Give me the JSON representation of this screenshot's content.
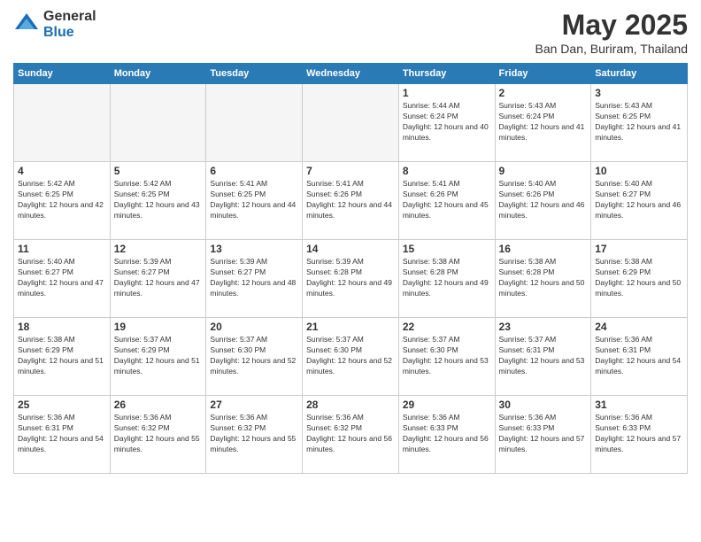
{
  "logo": {
    "general": "General",
    "blue": "Blue"
  },
  "title": "May 2025",
  "location": "Ban Dan, Buriram, Thailand",
  "weekdays": [
    "Sunday",
    "Monday",
    "Tuesday",
    "Wednesday",
    "Thursday",
    "Friday",
    "Saturday"
  ],
  "weeks": [
    [
      {
        "day": "",
        "empty": true
      },
      {
        "day": "",
        "empty": true
      },
      {
        "day": "",
        "empty": true
      },
      {
        "day": "",
        "empty": true
      },
      {
        "day": "1",
        "sunrise": "5:44 AM",
        "sunset": "6:24 PM",
        "daylight": "12 hours and 40 minutes."
      },
      {
        "day": "2",
        "sunrise": "5:43 AM",
        "sunset": "6:24 PM",
        "daylight": "12 hours and 41 minutes."
      },
      {
        "day": "3",
        "sunrise": "5:43 AM",
        "sunset": "6:25 PM",
        "daylight": "12 hours and 41 minutes."
      }
    ],
    [
      {
        "day": "4",
        "sunrise": "5:42 AM",
        "sunset": "6:25 PM",
        "daylight": "12 hours and 42 minutes."
      },
      {
        "day": "5",
        "sunrise": "5:42 AM",
        "sunset": "6:25 PM",
        "daylight": "12 hours and 43 minutes."
      },
      {
        "day": "6",
        "sunrise": "5:41 AM",
        "sunset": "6:25 PM",
        "daylight": "12 hours and 44 minutes."
      },
      {
        "day": "7",
        "sunrise": "5:41 AM",
        "sunset": "6:26 PM",
        "daylight": "12 hours and 44 minutes."
      },
      {
        "day": "8",
        "sunrise": "5:41 AM",
        "sunset": "6:26 PM",
        "daylight": "12 hours and 45 minutes."
      },
      {
        "day": "9",
        "sunrise": "5:40 AM",
        "sunset": "6:26 PM",
        "daylight": "12 hours and 46 minutes."
      },
      {
        "day": "10",
        "sunrise": "5:40 AM",
        "sunset": "6:27 PM",
        "daylight": "12 hours and 46 minutes."
      }
    ],
    [
      {
        "day": "11",
        "sunrise": "5:40 AM",
        "sunset": "6:27 PM",
        "daylight": "12 hours and 47 minutes."
      },
      {
        "day": "12",
        "sunrise": "5:39 AM",
        "sunset": "6:27 PM",
        "daylight": "12 hours and 47 minutes."
      },
      {
        "day": "13",
        "sunrise": "5:39 AM",
        "sunset": "6:27 PM",
        "daylight": "12 hours and 48 minutes."
      },
      {
        "day": "14",
        "sunrise": "5:39 AM",
        "sunset": "6:28 PM",
        "daylight": "12 hours and 49 minutes."
      },
      {
        "day": "15",
        "sunrise": "5:38 AM",
        "sunset": "6:28 PM",
        "daylight": "12 hours and 49 minutes."
      },
      {
        "day": "16",
        "sunrise": "5:38 AM",
        "sunset": "6:28 PM",
        "daylight": "12 hours and 50 minutes."
      },
      {
        "day": "17",
        "sunrise": "5:38 AM",
        "sunset": "6:29 PM",
        "daylight": "12 hours and 50 minutes."
      }
    ],
    [
      {
        "day": "18",
        "sunrise": "5:38 AM",
        "sunset": "6:29 PM",
        "daylight": "12 hours and 51 minutes."
      },
      {
        "day": "19",
        "sunrise": "5:37 AM",
        "sunset": "6:29 PM",
        "daylight": "12 hours and 51 minutes."
      },
      {
        "day": "20",
        "sunrise": "5:37 AM",
        "sunset": "6:30 PM",
        "daylight": "12 hours and 52 minutes."
      },
      {
        "day": "21",
        "sunrise": "5:37 AM",
        "sunset": "6:30 PM",
        "daylight": "12 hours and 52 minutes."
      },
      {
        "day": "22",
        "sunrise": "5:37 AM",
        "sunset": "6:30 PM",
        "daylight": "12 hours and 53 minutes."
      },
      {
        "day": "23",
        "sunrise": "5:37 AM",
        "sunset": "6:31 PM",
        "daylight": "12 hours and 53 minutes."
      },
      {
        "day": "24",
        "sunrise": "5:36 AM",
        "sunset": "6:31 PM",
        "daylight": "12 hours and 54 minutes."
      }
    ],
    [
      {
        "day": "25",
        "sunrise": "5:36 AM",
        "sunset": "6:31 PM",
        "daylight": "12 hours and 54 minutes."
      },
      {
        "day": "26",
        "sunrise": "5:36 AM",
        "sunset": "6:32 PM",
        "daylight": "12 hours and 55 minutes."
      },
      {
        "day": "27",
        "sunrise": "5:36 AM",
        "sunset": "6:32 PM",
        "daylight": "12 hours and 55 minutes."
      },
      {
        "day": "28",
        "sunrise": "5:36 AM",
        "sunset": "6:32 PM",
        "daylight": "12 hours and 56 minutes."
      },
      {
        "day": "29",
        "sunrise": "5:36 AM",
        "sunset": "6:33 PM",
        "daylight": "12 hours and 56 minutes."
      },
      {
        "day": "30",
        "sunrise": "5:36 AM",
        "sunset": "6:33 PM",
        "daylight": "12 hours and 57 minutes."
      },
      {
        "day": "31",
        "sunrise": "5:36 AM",
        "sunset": "6:33 PM",
        "daylight": "12 hours and 57 minutes."
      }
    ]
  ]
}
